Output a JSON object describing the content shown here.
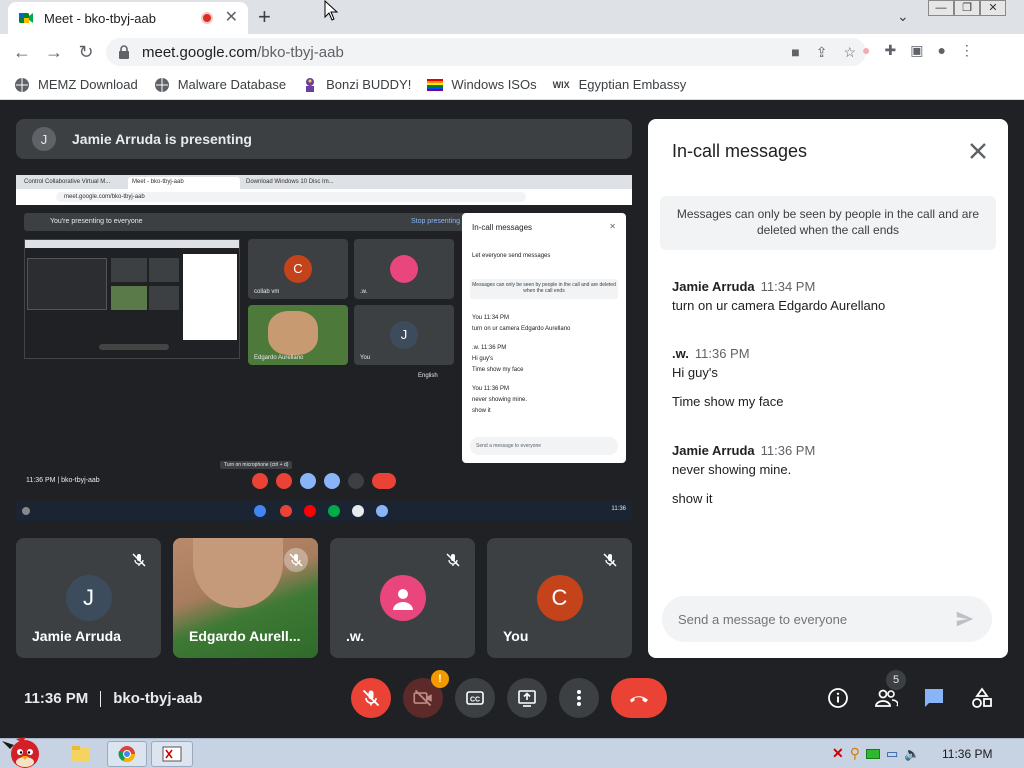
{
  "browser": {
    "tab_title": "Meet - bko-tbyj-aab",
    "url_host": "meet.google.com",
    "url_path": "/bko-tbyj-aab",
    "new_tab_label": "+",
    "bookmarks": [
      {
        "label": "MEMZ Download",
        "icon": "globe-icon"
      },
      {
        "label": "Malware Database",
        "icon": "globe-icon"
      },
      {
        "label": "Bonzi BUDDY!",
        "icon": "bonzi-icon"
      },
      {
        "label": "Windows ISOs",
        "icon": "rainbow-flag-icon"
      },
      {
        "label": "Egyptian Embassy",
        "icon": "wix-icon",
        "icon_text": "WIX"
      }
    ]
  },
  "meet": {
    "presenting_banner": "Jamie Arruda is presenting",
    "presenter_initial": "J",
    "participants": [
      {
        "name": "Jamie Arruda",
        "initial": "J",
        "avatar_color": "#3c4c5c"
      },
      {
        "name": "Edgardo Aurell...",
        "initial": "",
        "avatar_color": ""
      },
      {
        "name": ".w.",
        "initial": "",
        "avatar_color": "#e8467c"
      },
      {
        "name": "You",
        "initial": "C",
        "avatar_color": "#c5431a"
      }
    ],
    "time": "11:36 PM",
    "meeting_code": "bko-tbyj-aab",
    "people_count": "5",
    "camera_warning": "!"
  },
  "shared_screen": {
    "tabs": [
      "Control Collaborative Virtual M...",
      "Meet - bko-tbyj-aab",
      "Download Windows 10 Disc Im..."
    ],
    "url": "meet.google.com/bko-tbyj-aab",
    "banner": "You're presenting to everyone",
    "stop": "Stop presenting",
    "tiles": [
      {
        "name": "collab vm",
        "initial": "C"
      },
      {
        "name": ".w.",
        "initial": ""
      },
      {
        "name": "Edgardo Aurellano",
        "initial": ""
      },
      {
        "name": "You",
        "initial": "J"
      }
    ],
    "language": "English",
    "chat_title": "In-call messages",
    "chat_toggle": "Let everyone send messages",
    "chat_note": "Messages can only be seen by people in the call and are deleted when the call ends",
    "chat_lines": [
      "You  11:34 PM",
      "turn on ur camera Edgardo Aurellano",
      ".w.  11:36 PM",
      "Hi guy's",
      "Time show my face",
      "You  11:36 PM",
      "never showing mine.",
      "show it"
    ],
    "chat_input": "Send a message to everyone",
    "time_code": "11:36 PM  |  bko-tbyj-aab",
    "tooltip": "Turn on microphone (ctrl + d)",
    "tray_time": "11:36"
  },
  "chat": {
    "title": "In-call messages",
    "notice": "Messages can only be seen by people in the call and are deleted when the call ends",
    "messages": [
      {
        "sender": "Jamie Arruda",
        "time": "11:34 PM",
        "lines": [
          "turn on ur camera Edgardo Aurellano"
        ]
      },
      {
        "sender": ".w.",
        "time": "11:36 PM",
        "lines": [
          "Hi guy's",
          "Time show my face"
        ]
      },
      {
        "sender": "Jamie Arruda",
        "time": "11:36 PM",
        "lines": [
          "never showing mine.",
          "show it"
        ]
      }
    ],
    "input_placeholder": "Send a message to everyone"
  },
  "taskbar": {
    "time": "11:36 PM"
  },
  "colors": {
    "meet_bg": "#202124",
    "tile_bg": "#3c4043",
    "end_call": "#ea4335",
    "accent_blue": "#8ab4f8"
  }
}
